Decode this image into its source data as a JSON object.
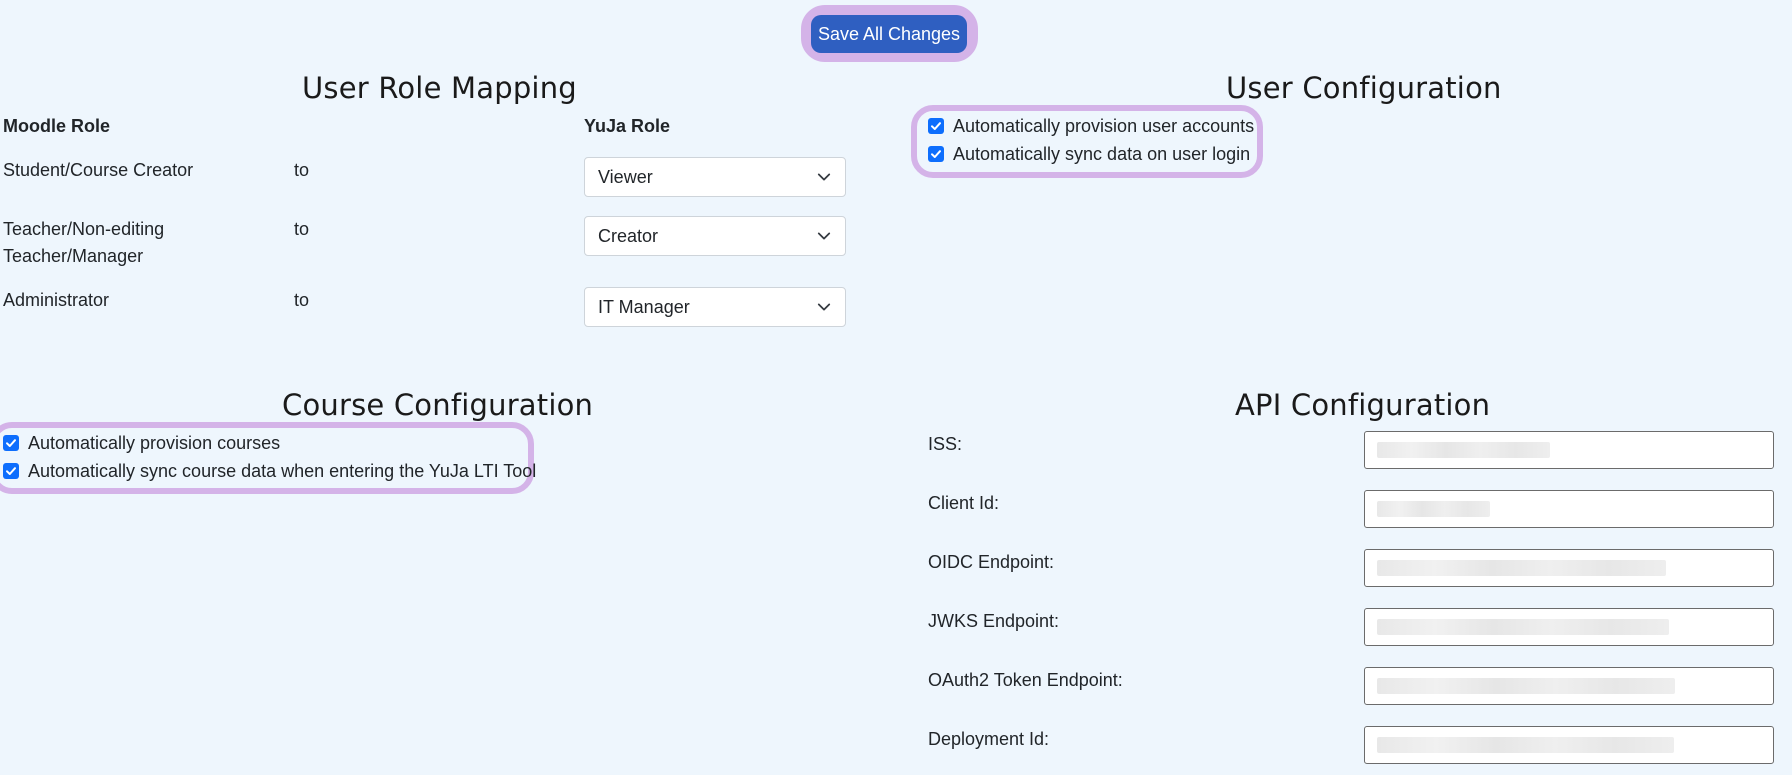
{
  "toolbar": {
    "save_label": "Save All Changes"
  },
  "user_role_mapping": {
    "title": "User Role Mapping",
    "moodle_header": "Moodle Role",
    "yuja_header": "YuJa Role",
    "rows": [
      {
        "moodle": "Student/Course Creator",
        "connector": "to",
        "yuja": "Viewer"
      },
      {
        "moodle_line1": "Teacher/Non-editing",
        "moodle_line2": "Teacher/Manager",
        "connector": "to",
        "yuja": "Creator"
      },
      {
        "moodle": "Administrator",
        "connector": "to",
        "yuja": "IT Manager"
      }
    ]
  },
  "user_configuration": {
    "title": "User Configuration",
    "options": [
      {
        "label": "Automatically provision user accounts",
        "checked": true
      },
      {
        "label": "Automatically sync data on user login",
        "checked": true
      }
    ]
  },
  "course_configuration": {
    "title": "Course Configuration",
    "options": [
      {
        "label": "Automatically provision courses",
        "checked": true
      },
      {
        "label": "Automatically sync course data when entering the YuJa LTI Tool",
        "checked": true
      }
    ]
  },
  "api_configuration": {
    "title": "API Configuration",
    "fields": [
      {
        "label": "ISS:"
      },
      {
        "label": "Client Id:"
      },
      {
        "label": "OIDC Endpoint:"
      },
      {
        "label": "JWKS Endpoint:"
      },
      {
        "label": "OAuth2 Token Endpoint:"
      },
      {
        "label": "Deployment Id:"
      }
    ]
  },
  "colors": {
    "page_background": "#eef6fd",
    "primary_button": "#2f5fc1",
    "checkbox": "#0d6efd",
    "highlight": "#d4b3e8"
  }
}
